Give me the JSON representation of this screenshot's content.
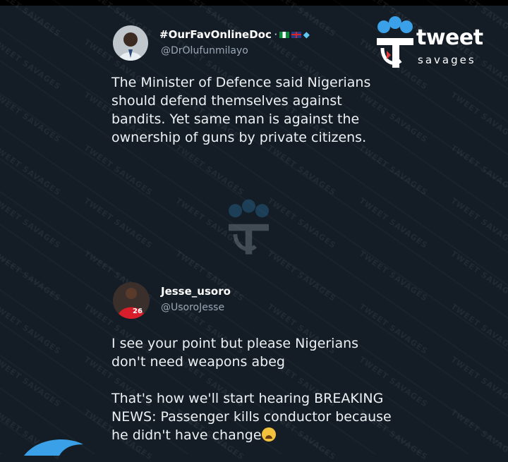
{
  "brand": {
    "name": "tweet",
    "sub": "savages"
  },
  "watermark_text": "TWEET SAVAGES",
  "tweet1": {
    "display_name": "#OurFavOnlineDoc",
    "handle": "@DrOlufunmilayo",
    "text": "The Minister of Defence said Nigerians\nshould defend themselves against\nbandits. Yet same man is against the\nownership of guns by private citizens."
  },
  "tweet2": {
    "display_name": "Jesse_usoro",
    "handle": "@UsoroJesse",
    "jersey_number": "26",
    "text": "I see your point but please Nigerians\ndon't need weapons abeg\n\nThat's how we'll start hearing BREAKING\nNEWS: Passenger kills conductor because\nhe didn't have change"
  },
  "icons": [
    "tweet-savages-logo-icon",
    "twitter-bird-icon",
    "weary-face-emoji-icon",
    "diamond-icon"
  ],
  "colors": {
    "background": "#141d26",
    "accent_blue": "#3aa0e8",
    "text": "#eef1f4",
    "handle": "#9aa7b4"
  }
}
